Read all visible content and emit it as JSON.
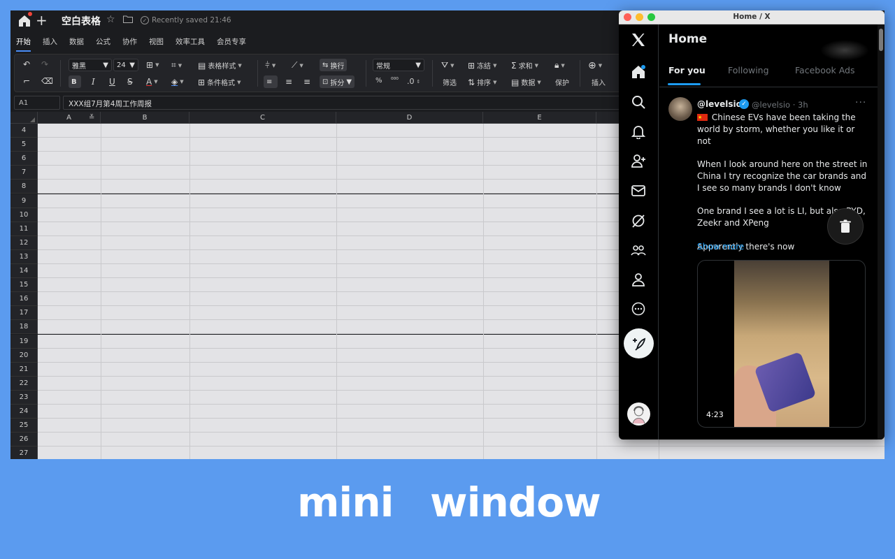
{
  "sheet": {
    "doc_title": "空白表格",
    "saved_status": "Recently saved 21:46",
    "menu": [
      "开始",
      "插入",
      "数据",
      "公式",
      "协作",
      "视图",
      "效率工具",
      "会员专享"
    ],
    "toolbar": {
      "font_name": "雅黑",
      "font_size": "24",
      "table_style": "表格样式",
      "cond_format": "条件格式",
      "wrap": "换行",
      "split": "拆分",
      "number_format": "常规",
      "percent": "%",
      "decimal": ".0",
      "freeze": "冻结",
      "sum": "求和",
      "filter": "筛选",
      "sort": "排序",
      "data": "数据",
      "protect": "保护",
      "insert": "插入"
    },
    "cell_ref": "A1",
    "formula": "XXX组7月第4周工作周报",
    "columns": [
      "A",
      "B",
      "C",
      "D",
      "E"
    ],
    "rows": [
      "4",
      "5",
      "6",
      "7",
      "8",
      "9",
      "10",
      "11",
      "12",
      "13",
      "14",
      "15",
      "16",
      "17",
      "18",
      "19",
      "20",
      "21",
      "22",
      "23",
      "24",
      "25",
      "26",
      "27"
    ]
  },
  "x": {
    "window_title": "Home / X",
    "home_title": "Home",
    "tabs": [
      "For you",
      "Following",
      "Facebook Ads"
    ],
    "tweet": {
      "name": "@levelsio",
      "handle": "@levelsio · 3h",
      "more": "···",
      "paragraphs": [
        "Chinese EVs have been taking the world by storm, whether you like it or not",
        "When I look around here on the street in China I try  recognize the car brands and I see so many brands I don't know",
        "One brand I see a lot is LI, but also BYD, Zeekr and XPeng",
        "Apparently there's now"
      ],
      "show_more": "Show more",
      "duration": "4:23"
    }
  },
  "caption": {
    "word1": "mini",
    "word2": "window"
  },
  "colors": {
    "background": "#5b9bef",
    "x_blue": "#1d9bf0",
    "sheet_dark": "#1b1c1f"
  }
}
